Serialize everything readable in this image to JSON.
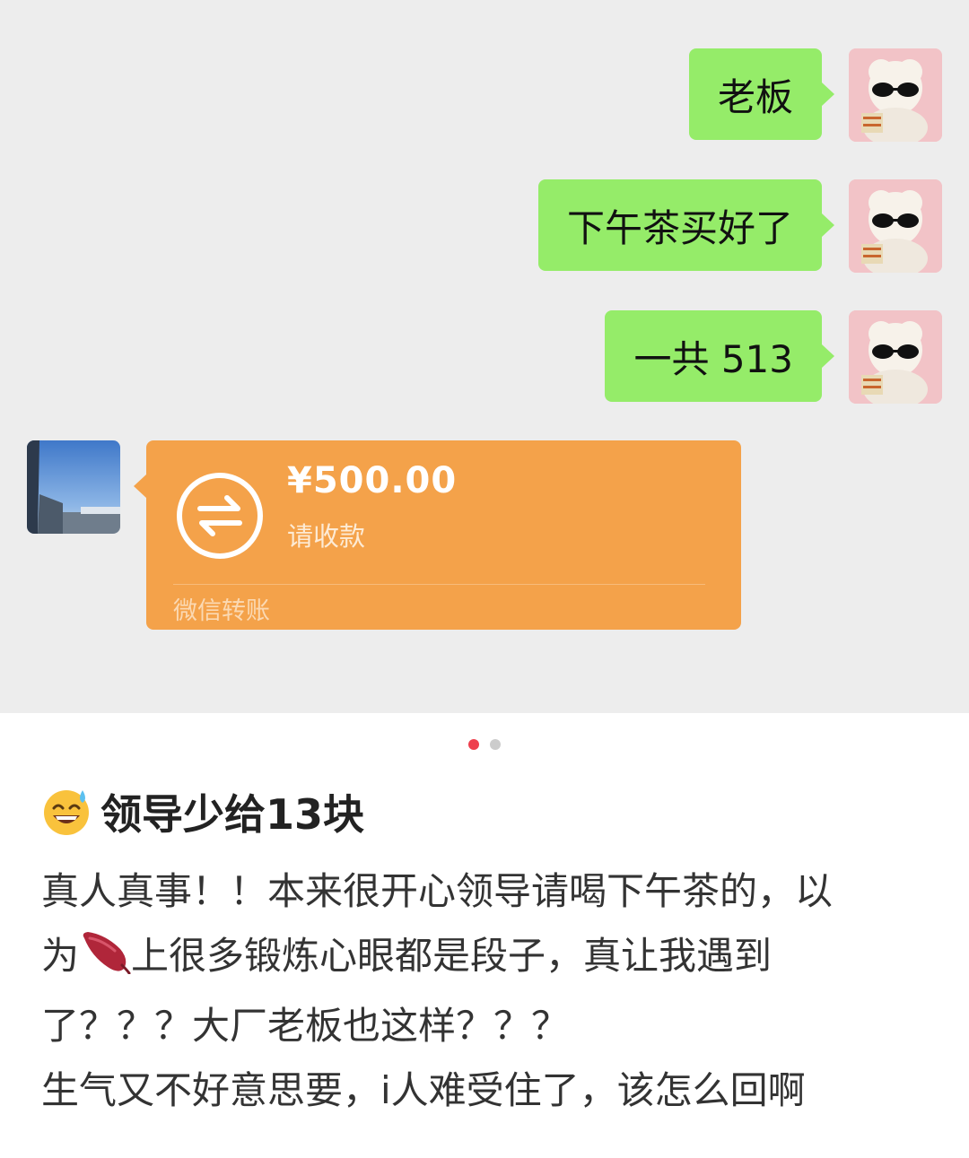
{
  "chat": {
    "outgoing": [
      {
        "text": "老板"
      },
      {
        "text": "下午茶买好了"
      },
      {
        "text": "一共 513"
      }
    ],
    "transfer": {
      "amount": "¥500.00",
      "status": "请收款",
      "footer": "微信转账"
    }
  },
  "carousel": {
    "count": 2,
    "active": 0
  },
  "post": {
    "title": "领导少给13块",
    "title_icon": "sweat-smile-emoji",
    "body": {
      "line1": "真人真事！！本来很开心领导请喝下午茶的，以",
      "line2_pre": "为",
      "line2_icon": "sweet-potato-icon",
      "line2_post": "上很多锻炼心眼都是段子，真让我遇到",
      "line3": "了？？？大厂老板也这样？？？",
      "line4": "生气又不好意思要，i人难受住了，该怎么回啊"
    }
  },
  "colors": {
    "chat_bg": "#ededed",
    "bubble_green": "#95ec69",
    "transfer_orange": "#f4a24a",
    "dot_active": "#ee3f4d",
    "dot_inactive": "#cccccc"
  }
}
